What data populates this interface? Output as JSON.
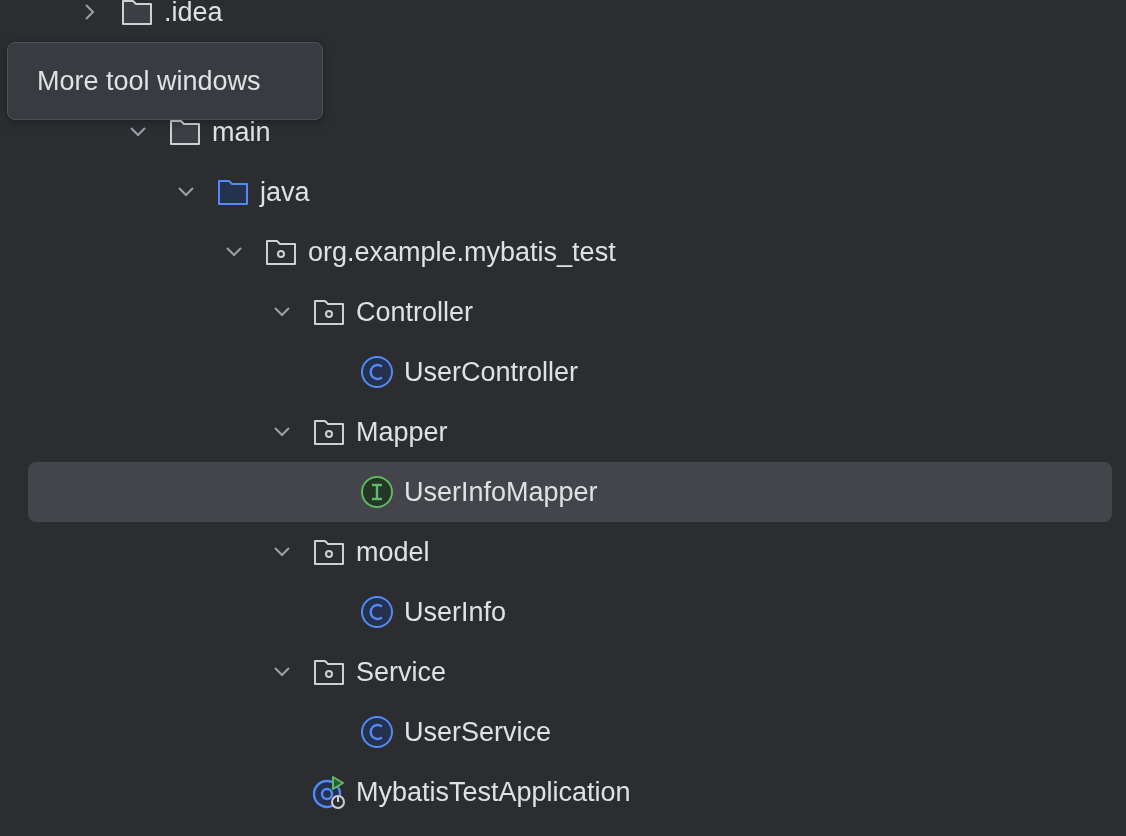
{
  "tree": [
    {
      "label": ".idea",
      "kind": "folder",
      "expanded": false,
      "selected": false
    },
    {
      "kind": "hidden",
      "children": [
        {
          "label": "main",
          "kind": "folder",
          "expanded": true,
          "selected": false,
          "children": [
            {
              "label": "java",
              "kind": "source-folder",
              "expanded": true,
              "selected": false,
              "children": [
                {
                  "label": "org.example.mybatis_test",
                  "kind": "package",
                  "expanded": true,
                  "selected": false,
                  "children": [
                    {
                      "label": "Controller",
                      "kind": "package",
                      "expanded": true,
                      "selected": false,
                      "children": [
                        {
                          "label": "UserController",
                          "kind": "class",
                          "selected": false
                        }
                      ]
                    },
                    {
                      "label": "Mapper",
                      "kind": "package",
                      "expanded": true,
                      "selected": false,
                      "children": [
                        {
                          "label": "UserInfoMapper",
                          "kind": "interface",
                          "selected": true
                        }
                      ]
                    },
                    {
                      "label": "model",
                      "kind": "package",
                      "expanded": true,
                      "selected": false,
                      "children": [
                        {
                          "label": "UserInfo",
                          "kind": "class",
                          "selected": false
                        }
                      ]
                    },
                    {
                      "label": "Service",
                      "kind": "package",
                      "expanded": true,
                      "selected": false,
                      "children": [
                        {
                          "label": "UserService",
                          "kind": "class",
                          "selected": false
                        }
                      ]
                    },
                    {
                      "label": "MybatisTestApplication",
                      "kind": "application",
                      "selected": false
                    }
                  ]
                }
              ]
            }
          ]
        }
      ]
    }
  ],
  "tooltip": {
    "text": "More tool windows"
  }
}
